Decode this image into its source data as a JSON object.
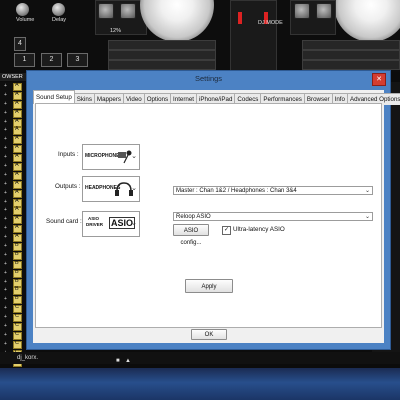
{
  "background": {
    "knob_labels": [
      "Volume",
      "Delay"
    ],
    "bank_buttons": [
      "1",
      "2",
      "3",
      "4"
    ],
    "pitch_value": "12%",
    "dj_label_top": "DJ MODE",
    "browser_title": "OWSER",
    "tree_letters": [
      "A",
      "A",
      "A",
      "A",
      "A",
      "A",
      "A",
      "A",
      "A",
      "A",
      "A",
      "A",
      "A",
      "A",
      "A",
      "A",
      "A",
      "A",
      "B",
      "B",
      "B",
      "B",
      "B",
      "B",
      "B",
      "C",
      "C",
      "C",
      "C",
      "C",
      "C",
      "C",
      "C"
    ],
    "status_user": "dj_korx."
  },
  "window": {
    "title": "Settings",
    "close_glyph": "✕",
    "tabs": [
      "Sound Setup",
      "Skins",
      "Mappers",
      "Video",
      "Options",
      "Internet",
      "iPhone/iPad",
      "Codecs",
      "Performances",
      "Browser",
      "Info",
      "Advanced Options"
    ],
    "active_tab": "Sound Setup",
    "inputs": {
      "label": "Inputs :",
      "device": "MICROPHONE"
    },
    "outputs": {
      "label": "Outputs :",
      "device": "HEADPHONES",
      "routing": "Master : Chan 1&2 / Headphones : Chan 3&4"
    },
    "sound_card": {
      "label": "Sound card :",
      "device_line1": "ASIO",
      "device_line2": "DRIVER",
      "device_logo": "ASIO",
      "driver": "Reloop ASIO",
      "config_button": "ASIO config...",
      "low_latency_label": "Ultra-latency ASIO",
      "low_latency_checked": true
    },
    "apply_button": "Apply",
    "ok_button": "OK"
  }
}
